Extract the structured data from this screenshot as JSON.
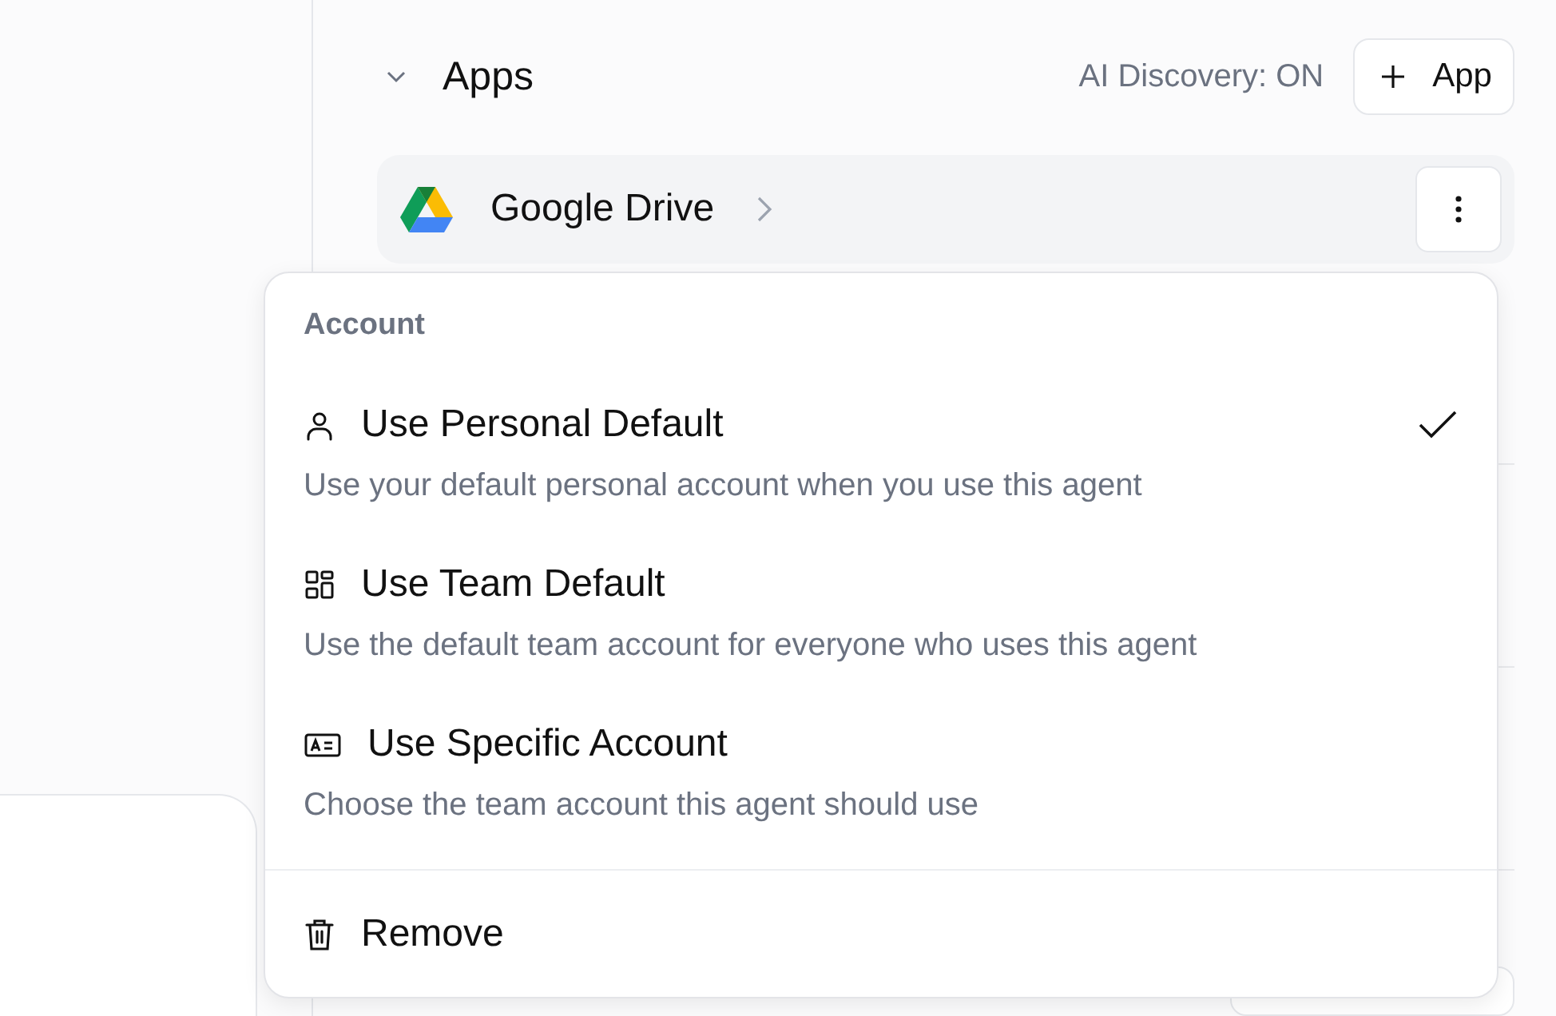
{
  "section": {
    "title": "Apps",
    "expanded": true,
    "discovery": "AI Discovery: ON",
    "add_button": {
      "label": "App"
    }
  },
  "apps": [
    {
      "name": "Google Drive"
    }
  ],
  "menu": {
    "heading": "Account",
    "options": [
      {
        "kind": "person",
        "title": "Use Personal Default",
        "description": "Use your default personal account when you use this agent",
        "selected": true
      },
      {
        "kind": "grid",
        "title": "Use Team Default",
        "description": "Use the default team account for everyone who uses this agent",
        "selected": false
      },
      {
        "kind": "id-card",
        "title": "Use Specific Account",
        "description": "Choose the team account this agent should use",
        "selected": false
      }
    ],
    "actions": [
      {
        "kind": "trash",
        "label": "Remove"
      }
    ]
  }
}
